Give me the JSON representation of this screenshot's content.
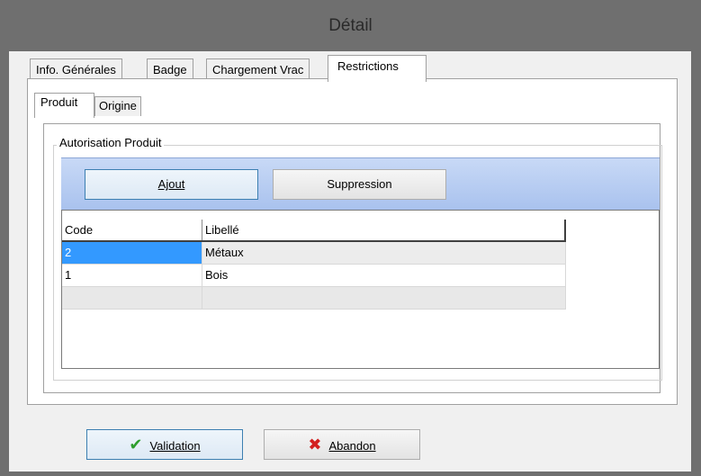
{
  "window": {
    "title": "Détail"
  },
  "tabs": [
    {
      "label": "Info. Générales"
    },
    {
      "label": "Badge"
    },
    {
      "label": "Chargement Vrac"
    },
    {
      "label": "Restrictions"
    }
  ],
  "subtabs": [
    {
      "label": "Produit"
    },
    {
      "label": "Origine"
    }
  ],
  "group": {
    "title": "Autorisation Produit"
  },
  "toolbar": {
    "add_label": "Ajout",
    "delete_label": "Suppression"
  },
  "grid": {
    "headers": [
      "Code",
      "Libellé"
    ],
    "rows": [
      {
        "code": "2",
        "label": "Métaux"
      },
      {
        "code": "1",
        "label": "Bois"
      }
    ]
  },
  "footer": {
    "validate_label": "Validation",
    "cancel_label": "Abandon"
  },
  "colors": {
    "selection": "#3399ff",
    "toolbar_top": "#c8d9f6",
    "toolbar_bottom": "#a9c2ee",
    "validate_icon": "#2e9e2e",
    "cancel_icon": "#d32020"
  },
  "icons": {
    "validate": "check-icon",
    "cancel": "x-icon"
  }
}
